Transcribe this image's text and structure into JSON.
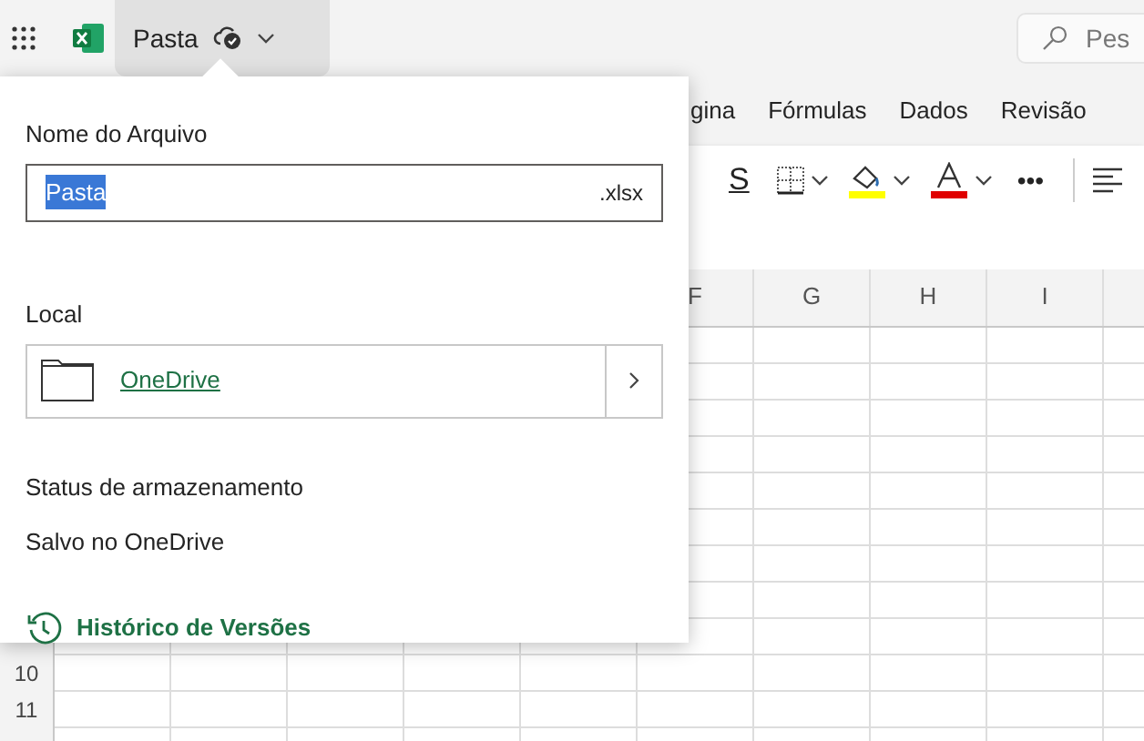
{
  "app_bar": {
    "title_button": {
      "label": "Pasta",
      "expanded": true
    },
    "search": {
      "placeholder": "Pes"
    }
  },
  "ribbon_tabs": [
    {
      "label": "gina"
    },
    {
      "label": "Fórmulas"
    },
    {
      "label": "Dados"
    },
    {
      "label": "Revisão"
    }
  ],
  "toolbar": {
    "underline_label": "S",
    "more_label": "•••"
  },
  "sheet": {
    "columns": [
      "F",
      "G",
      "H",
      "I"
    ],
    "rows": [
      "10",
      "11"
    ]
  },
  "file_popup": {
    "file_name_label": "Nome do Arquivo",
    "file_name": {
      "value": "Pasta",
      "selected": true,
      "extension": ".xlsx"
    },
    "location_label": "Local",
    "location": {
      "label": "OneDrive"
    },
    "storage_status_label": "Status de armazenamento",
    "storage_status": "Salvo no OneDrive",
    "version_history": "Histórico de Versões"
  }
}
